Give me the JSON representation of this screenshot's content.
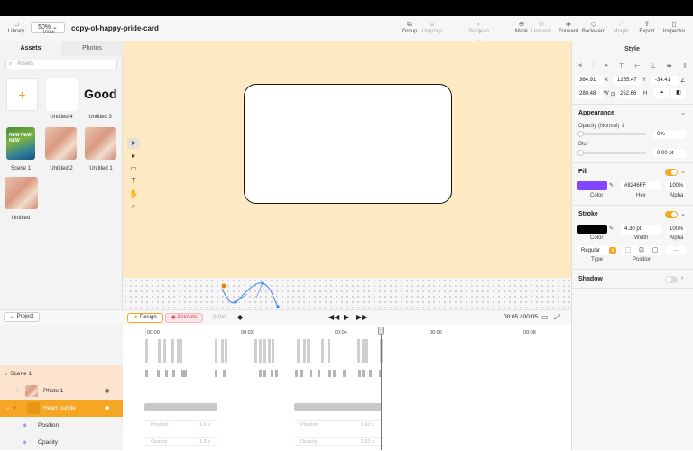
{
  "app": {
    "document_title": "copy-of-happy-pride-card",
    "zoom": "50%"
  },
  "toolbar": {
    "library": "Library",
    "view": "View",
    "group": "Group",
    "ungroup": "Ungroup",
    "boolean": "Boolean",
    "mask": "Mask",
    "unmask": "Unmask",
    "forward": "Forward",
    "backward": "Backward",
    "morph": "Morph",
    "export": "Export",
    "inspector": "Inspector"
  },
  "left_panel": {
    "tabs": [
      "Assets",
      "Photos"
    ],
    "search_placeholder": "Assets",
    "assets": [
      {
        "label": "",
        "kind": "add"
      },
      {
        "label": "Untitled 4",
        "kind": "blank"
      },
      {
        "label": "Untitled 3",
        "kind": "text",
        "text": "Good"
      },
      {
        "label": "Scene 1",
        "kind": "scene",
        "text": "NEW NEW NEW"
      },
      {
        "label": "Untitled 2",
        "kind": "photo"
      },
      {
        "label": "Untitled 1",
        "kind": "photo"
      },
      {
        "label": "Untitled",
        "kind": "photo"
      }
    ],
    "project_button": "Project"
  },
  "inspector": {
    "title": "Style",
    "x": "364.91",
    "x_label": "X",
    "y": "1255.47",
    "y_label": "Y",
    "rotation": "-34.41",
    "w": "280.48",
    "w_label": "W",
    "h": "252.66",
    "h_label": "H",
    "appearance": {
      "title": "Appearance",
      "opacity_label": "Opacity (Normal)",
      "opacity_value": "0%",
      "blur_label": "Blur",
      "blur_value": "0.00 pt"
    },
    "fill": {
      "title": "Fill",
      "color": "#8246FF",
      "hex": "#8246FF",
      "alpha": "100%",
      "color_label": "Color",
      "hex_label": "Hex",
      "alpha_label": "Alpha"
    },
    "stroke": {
      "title": "Stroke",
      "color": "#000000",
      "width": "4.30 pt",
      "alpha": "100%",
      "color_label": "Color",
      "width_label": "Width",
      "alpha_label": "Alpha",
      "type": "Regular",
      "type_label": "Type",
      "position_label": "Position"
    },
    "shadow": {
      "title": "Shadow"
    }
  },
  "timeline": {
    "modes": [
      "Design",
      "Animate",
      "Pin"
    ],
    "time": "00:05 / 00:05",
    "ticks": [
      "00:00",
      "00:02",
      "00:04",
      "00:06",
      "00:08"
    ],
    "layers": [
      {
        "name": "Scene 1"
      },
      {
        "name": "Photo 1"
      },
      {
        "name": "Heart purple"
      },
      {
        "name": "Position"
      },
      {
        "name": "Opacity"
      }
    ],
    "segments": [
      {
        "label": "Position",
        "duration": "1.6 s"
      },
      {
        "label": "Position",
        "duration": "1.63 s"
      },
      {
        "label": "Opacity",
        "duration": "1.6 s"
      },
      {
        "label": "Opacity",
        "duration": "1.63 s"
      }
    ]
  },
  "colors": {
    "accent": "#F5A623",
    "canvas": "#FDE9C2",
    "fill": "#8246FF"
  }
}
